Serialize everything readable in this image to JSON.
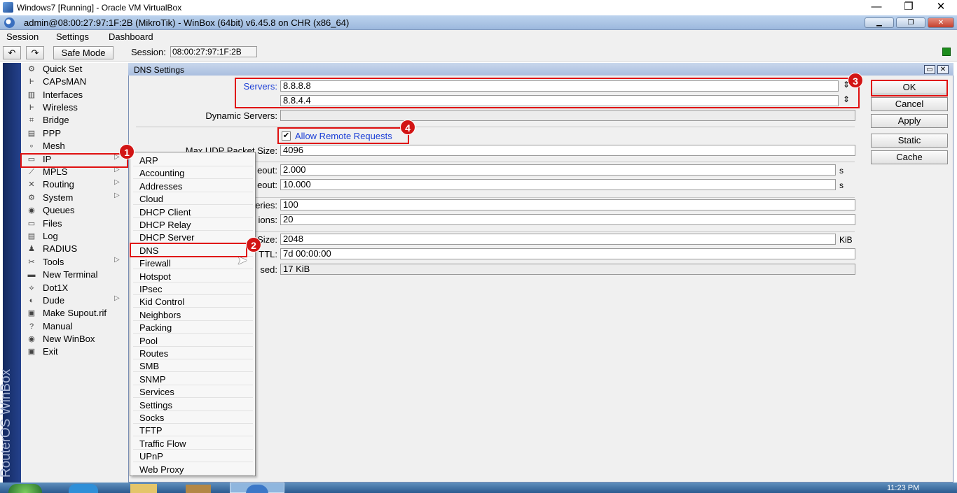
{
  "vbox": {
    "title": "Windows7 [Running] - Oracle VM VirtualBox",
    "min": "—",
    "max": "❐",
    "close": "✕"
  },
  "winbox": {
    "title": "admin@08:00:27:97:1F:2B (MikroTik) - WinBox (64bit) v6.45.8 on CHR (x86_64)"
  },
  "menubar": [
    "Session",
    "Settings",
    "Dashboard"
  ],
  "toolbar": {
    "undo": "↶",
    "redo": "↷",
    "safe_mode": "Safe Mode",
    "session_label": "Session:",
    "session_value": "08:00:27:97:1F:2B"
  },
  "brand": "RouterOS WinBox",
  "left_menu": [
    {
      "label": "Quick Set",
      "icon": "quick-set-icon",
      "glyph": "⚙"
    },
    {
      "label": "CAPsMAN",
      "icon": "capsman-icon",
      "glyph": "Ⱶ"
    },
    {
      "label": "Interfaces",
      "icon": "interfaces-icon",
      "glyph": "▥"
    },
    {
      "label": "Wireless",
      "icon": "wireless-icon",
      "glyph": "Ⱶ"
    },
    {
      "label": "Bridge",
      "icon": "bridge-icon",
      "glyph": "⌗"
    },
    {
      "label": "PPP",
      "icon": "ppp-icon",
      "glyph": "▤"
    },
    {
      "label": "Mesh",
      "icon": "mesh-icon",
      "glyph": "∘"
    },
    {
      "label": "IP",
      "icon": "ip-icon",
      "glyph": "▭",
      "arrow": "▷"
    },
    {
      "label": "MPLS",
      "icon": "mpls-icon",
      "glyph": "⟋",
      "arrow": "▷"
    },
    {
      "label": "Routing",
      "icon": "routing-icon",
      "glyph": "✕",
      "arrow": "▷"
    },
    {
      "label": "System",
      "icon": "system-icon",
      "glyph": "⚙",
      "arrow": "▷"
    },
    {
      "label": "Queues",
      "icon": "queues-icon",
      "glyph": "◉"
    },
    {
      "label": "Files",
      "icon": "files-icon",
      "glyph": "▭"
    },
    {
      "label": "Log",
      "icon": "log-icon",
      "glyph": "▤"
    },
    {
      "label": "RADIUS",
      "icon": "radius-icon",
      "glyph": "♟"
    },
    {
      "label": "Tools",
      "icon": "tools-icon",
      "glyph": "✂",
      "arrow": "▷"
    },
    {
      "label": "New Terminal",
      "icon": "terminal-icon",
      "glyph": "▬"
    },
    {
      "label": "Dot1X",
      "icon": "dot1x-icon",
      "glyph": "⟡"
    },
    {
      "label": "Dude",
      "icon": "dude-icon",
      "glyph": "◐",
      "arrow": "▷"
    },
    {
      "label": "Make Supout.rif",
      "icon": "supout-icon",
      "glyph": "▣"
    },
    {
      "label": "Manual",
      "icon": "manual-icon",
      "glyph": "?"
    },
    {
      "label": "New WinBox",
      "icon": "new-winbox-icon",
      "glyph": "◉"
    },
    {
      "label": "Exit",
      "icon": "exit-icon",
      "glyph": "▣"
    }
  ],
  "ip_submenu": [
    "ARP",
    "Accounting",
    "Addresses",
    "Cloud",
    "DHCP Client",
    "DHCP Relay",
    "DHCP Server",
    "DNS",
    "Firewall",
    "Hotspot",
    "IPsec",
    "Kid Control",
    "Neighbors",
    "Packing",
    "Pool",
    "Routes",
    "SMB",
    "SNMP",
    "Services",
    "Settings",
    "Socks",
    "TFTP",
    "Traffic Flow",
    "UPnP",
    "Web Proxy"
  ],
  "dns": {
    "title": "DNS Settings",
    "servers_label": "Servers:",
    "server1": "8.8.8.8",
    "server2": "8.8.4.4",
    "dynamic_label": "Dynamic Servers:",
    "allow_remote": "Allow Remote Requests",
    "check": "✔",
    "max_udp_label": "Max UDP Packet Size:",
    "max_udp": "4096",
    "query_server_label": "eout:",
    "query_server": "2.000",
    "query_total_label": "eout:",
    "query_total": "10.000",
    "s1": "s",
    "s2": "s",
    "max_queries_label": "eries:",
    "max_queries": "100",
    "max_conn_label": "ions:",
    "max_conn": "20",
    "cache_size_label": "Size:",
    "cache_size": "2048",
    "kib": "KiB",
    "cache_ttl_label": "TTL:",
    "cache_ttl": "7d 00:00:00",
    "cache_used_label": "sed:",
    "cache_used": "17 KiB"
  },
  "buttons": {
    "ok": "OK",
    "cancel": "Cancel",
    "apply": "Apply",
    "static": "Static",
    "cache": "Cache"
  },
  "badges": [
    "1",
    "2",
    "3",
    "4"
  ],
  "taskbar": {
    "time": "11:23 PM"
  },
  "colors": {
    "highlight": "#e01010",
    "link_blue": "#1c3fd6"
  }
}
